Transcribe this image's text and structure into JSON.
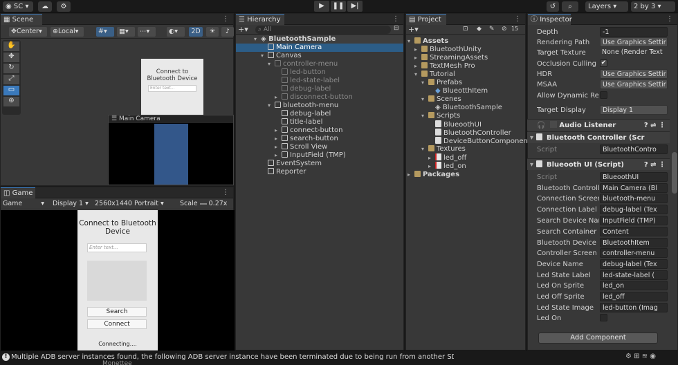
{
  "toolbar": {
    "account_label": "SC",
    "layers_label": "Layers",
    "layout_label": "2 by 3",
    "play_icon": "play-icon",
    "pause_icon": "pause-icon",
    "step_icon": "step-icon"
  },
  "scene": {
    "tab": "Scene",
    "pivot": "Center",
    "space": "Local",
    "mode_2d": "2D",
    "ui_title": "Connect to Bluetooth Device",
    "ui_placeholder": "Enter text...",
    "camera_preview_title": "Main Camera"
  },
  "game": {
    "tab": "Game",
    "view_mode": "Game",
    "display": "Display 1",
    "resolution": "2560x1440 Portrait",
    "scale_label": "Scale",
    "scale_value": "0.27x",
    "title": "Connect to Bluetooth Device",
    "placeholder": "Enter text...",
    "search_btn": "Search",
    "connect_btn": "Connect",
    "status": "Connecting....",
    "cut_text": "Monettee"
  },
  "hierarchy": {
    "tab": "Hierarchy",
    "search_placeholder": "All",
    "items": [
      {
        "label": "BluetoothSample",
        "arrow": "▾"
      },
      {
        "label": "Main Camera",
        "arrow": ""
      },
      {
        "label": "Canvas",
        "arrow": "▾"
      },
      {
        "label": "controller-menu",
        "arrow": "▾"
      },
      {
        "label": "led-button",
        "arrow": ""
      },
      {
        "label": "led-state-label",
        "arrow": ""
      },
      {
        "label": "debug-label",
        "arrow": ""
      },
      {
        "label": "disconnect-button",
        "arrow": "▸"
      },
      {
        "label": "bluetooth-menu",
        "arrow": "▾"
      },
      {
        "label": "debug-label",
        "arrow": ""
      },
      {
        "label": "title-label",
        "arrow": ""
      },
      {
        "label": "connect-button",
        "arrow": "▸"
      },
      {
        "label": "search-button",
        "arrow": "▸"
      },
      {
        "label": "Scroll View",
        "arrow": "▸"
      },
      {
        "label": "InputField (TMP)",
        "arrow": "▸"
      },
      {
        "label": "EventSystem",
        "arrow": ""
      },
      {
        "label": "Reporter",
        "arrow": ""
      }
    ]
  },
  "project": {
    "tab": "Project",
    "badge": "15",
    "items": [
      {
        "label": "Assets",
        "arrow": "▾"
      },
      {
        "label": "BluetoothUnity",
        "arrow": "▸"
      },
      {
        "label": "StreamingAssets",
        "arrow": "▸"
      },
      {
        "label": "TextMesh Pro",
        "arrow": "▸"
      },
      {
        "label": "Tutorial",
        "arrow": "▾"
      },
      {
        "label": "Prefabs",
        "arrow": "▾"
      },
      {
        "label": "BlueotthItem",
        "arrow": ""
      },
      {
        "label": "Scenes",
        "arrow": "▾"
      },
      {
        "label": "BluetoothSample",
        "arrow": ""
      },
      {
        "label": "Scripts",
        "arrow": "▾"
      },
      {
        "label": "BlueoothUI",
        "arrow": ""
      },
      {
        "label": "BluetoothController",
        "arrow": ""
      },
      {
        "label": "DeviceButtonComponent",
        "arrow": ""
      },
      {
        "label": "Textures",
        "arrow": "▾"
      },
      {
        "label": "led_off",
        "arrow": "▸"
      },
      {
        "label": "led_on",
        "arrow": "▸"
      },
      {
        "label": "Packages",
        "arrow": "▸"
      }
    ]
  },
  "inspector": {
    "tab": "Inspector",
    "camera_props": [
      {
        "label": "Depth",
        "value": "-1"
      },
      {
        "label": "Rendering Path",
        "value": "Use Graphics Settir"
      },
      {
        "label": "Target Texture",
        "value": "None (Render Text"
      },
      {
        "label": "Occlusion Culling",
        "value": ""
      },
      {
        "label": "HDR",
        "value": "Use Graphics Settir"
      },
      {
        "label": "MSAA",
        "value": "Use Graphics Settir"
      },
      {
        "label": "Allow Dynamic Reso",
        "value": ""
      },
      {
        "label": "Target Display",
        "value": "Display 1"
      }
    ],
    "audio_listener": "Audio Listener",
    "bt_controller": "Bluetooth Controller (Scr",
    "bt_controller_script_label": "Script",
    "bt_controller_script": "BluetoothContro",
    "bt_ui": "Blueooth UI (Script)",
    "ui_props": [
      {
        "label": "Script",
        "value": "BlueoothUI"
      },
      {
        "label": "Bluetooth Controller",
        "value": "Main Camera (Bl"
      },
      {
        "label": "Connection Screen",
        "value": "bluetooth-menu"
      },
      {
        "label": "Connection Label",
        "value": "debug-label (Tex"
      },
      {
        "label": "Search Device Name",
        "value": "InputField (TMP)"
      },
      {
        "label": "Search Container",
        "value": "Content"
      },
      {
        "label": "Bluetooth Device But",
        "value": "BluetoothItem"
      },
      {
        "label": "Controller Screen",
        "value": "controller-menu"
      },
      {
        "label": "Device Name",
        "value": "debug-label (Tex"
      },
      {
        "label": "Led State Label",
        "value": "led-state-label ("
      },
      {
        "label": "Led On Sprite",
        "value": "led_on"
      },
      {
        "label": "Led Off Sprite",
        "value": "led_off"
      },
      {
        "label": "Led State Image",
        "value": "led-button (Imag"
      },
      {
        "label": "Led On",
        "value": ""
      }
    ],
    "add_component": "Add Component"
  },
  "status_bar": {
    "message": "Multiple ADB server instances found, the following ADB server instance have been terminated due to being run from another SDK. Process paths:"
  }
}
